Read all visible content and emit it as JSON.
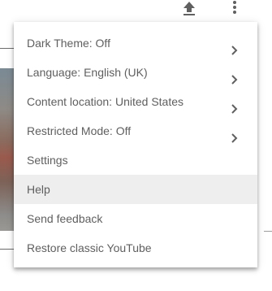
{
  "topbar": {
    "upload_icon": "upload-icon",
    "more_icon": "more-vert-icon"
  },
  "menu": {
    "items": [
      {
        "label": "Dark Theme: Off",
        "has_submenu": true
      },
      {
        "label": "Language: English (UK)",
        "has_submenu": true
      },
      {
        "label": "Content location: United States",
        "has_submenu": true
      },
      {
        "label": "Restricted Mode: Off",
        "has_submenu": true
      },
      {
        "label": "Settings",
        "has_submenu": false
      },
      {
        "label": "Help",
        "has_submenu": false,
        "highlighted": true
      },
      {
        "label": "Send feedback",
        "has_submenu": false
      },
      {
        "label": "Restore classic YouTube",
        "has_submenu": false
      }
    ]
  },
  "colors": {
    "menu_text": "#5f5f5f",
    "icon": "#606060",
    "hover_bg": "#eeeeee"
  }
}
